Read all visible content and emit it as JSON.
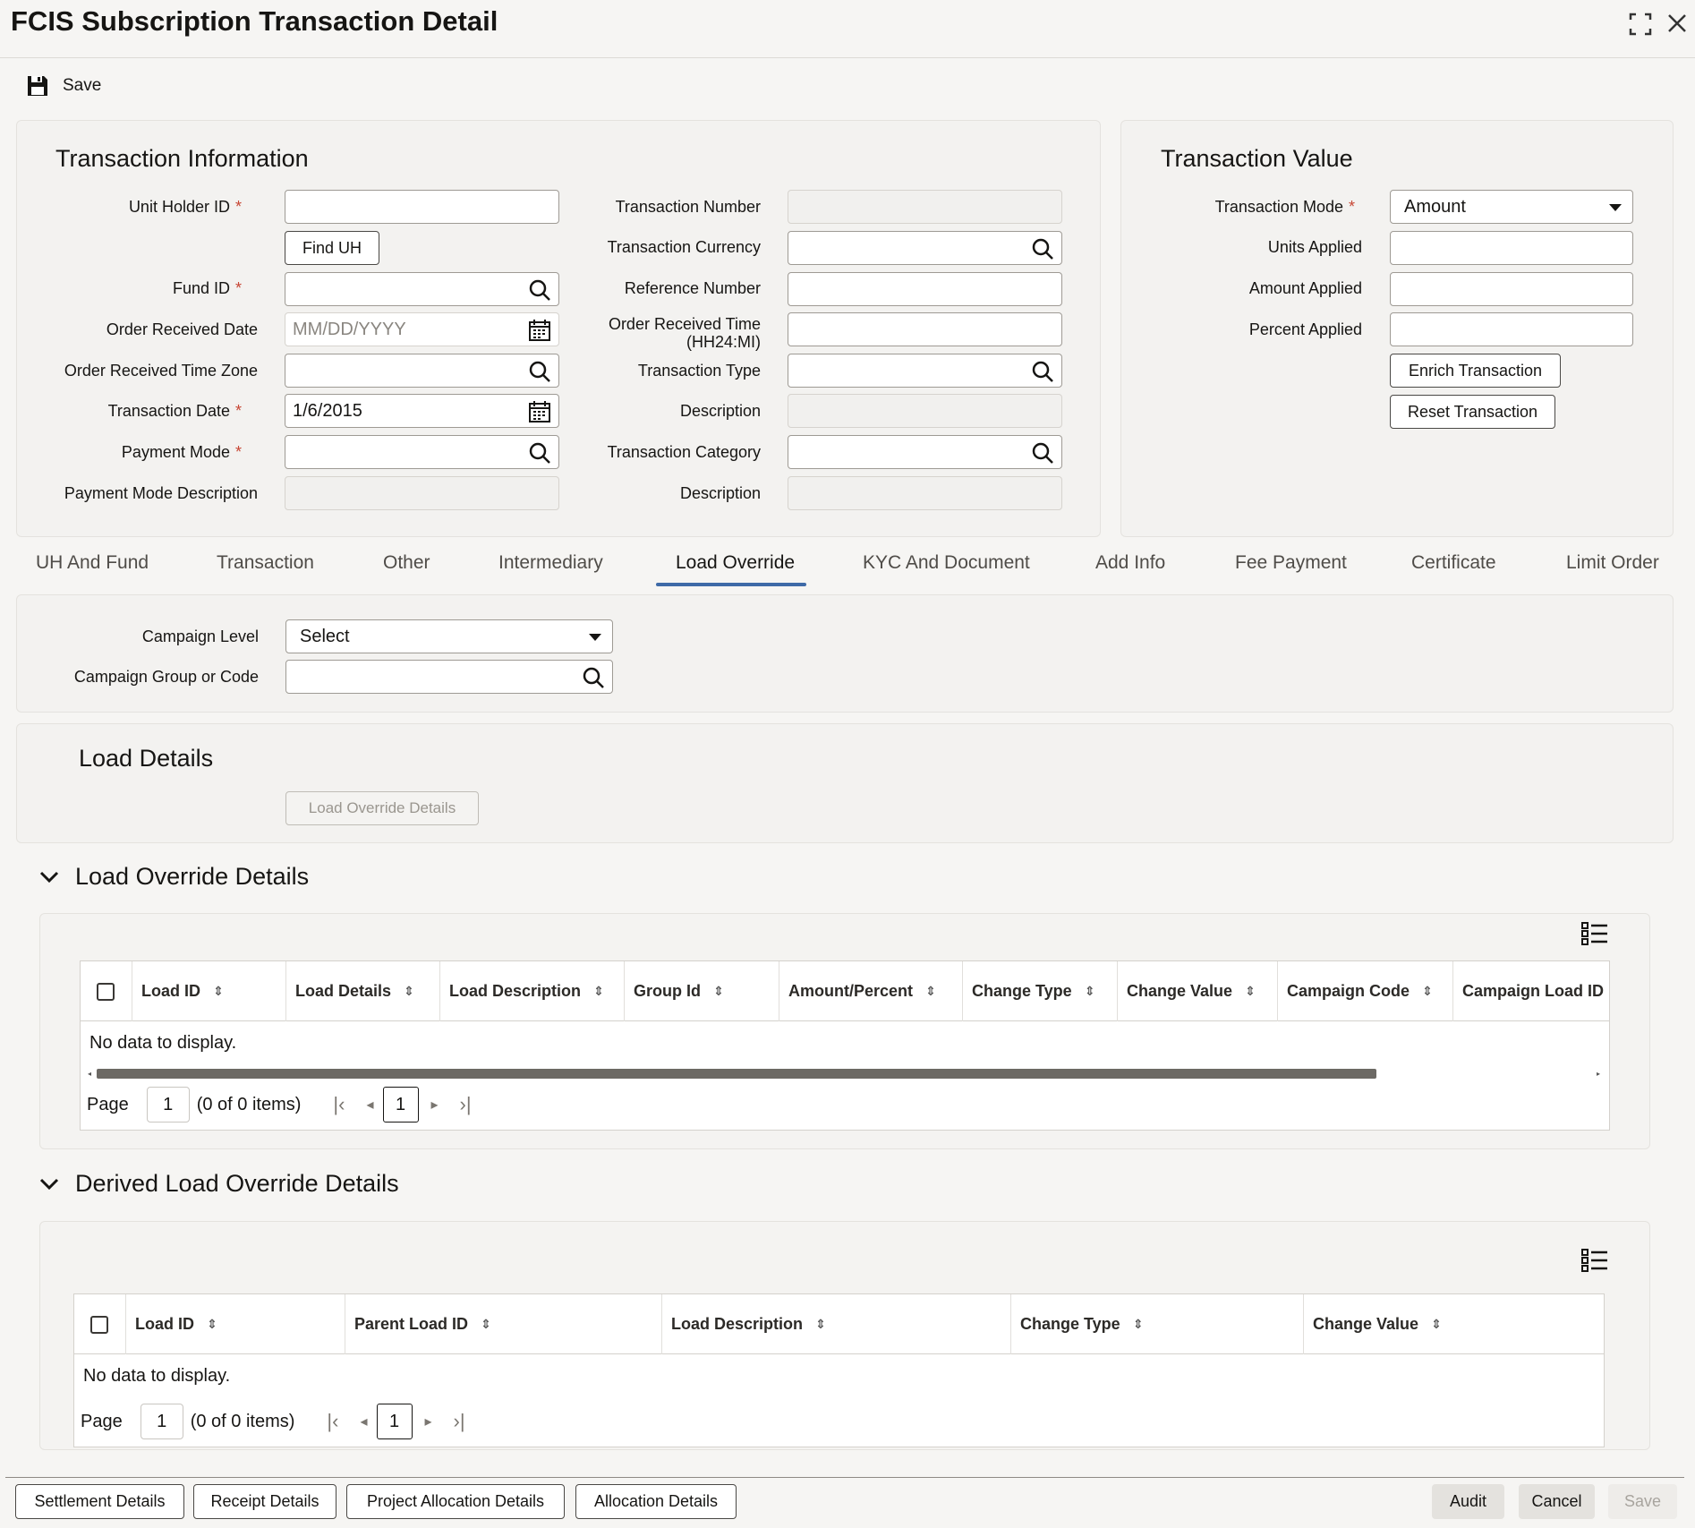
{
  "window": {
    "title": "FCIS Subscription Transaction Detail",
    "maximize_icon": "maximize-icon",
    "close_icon": "close-icon"
  },
  "toolbar": {
    "save_label": "Save"
  },
  "transaction_information": {
    "title": "Transaction Information",
    "unit_holder_id_label": "Unit Holder ID",
    "find_uh_label": "Find UH",
    "fund_id_label": "Fund ID",
    "order_received_date_label": "Order Received Date",
    "order_received_date_placeholder": "MM/DD/YYYY",
    "order_received_time_zone_label": "Order Received Time Zone",
    "transaction_date_label": "Transaction Date",
    "transaction_date_value": "1/6/2015",
    "payment_mode_label": "Payment Mode",
    "payment_mode_description_label": "Payment Mode Description",
    "transaction_number_label": "Transaction Number",
    "transaction_currency_label": "Transaction Currency",
    "reference_number_label": "Reference Number",
    "order_received_time_label_1": "Order Received Time",
    "order_received_time_label_2": "(HH24:MI)",
    "transaction_type_label": "Transaction Type",
    "description_label": "Description",
    "transaction_category_label": "Transaction Category",
    "description2_label": "Description",
    "required_mark": "*"
  },
  "transaction_value": {
    "title": "Transaction Value",
    "transaction_mode_label": "Transaction Mode",
    "transaction_mode_value": "Amount",
    "units_applied_label": "Units Applied",
    "amount_applied_label": "Amount Applied",
    "percent_applied_label": "Percent Applied",
    "enrich_label": "Enrich Transaction",
    "reset_label": "Reset Transaction"
  },
  "tabs": [
    {
      "label": "UH And Fund"
    },
    {
      "label": "Transaction"
    },
    {
      "label": "Other"
    },
    {
      "label": "Intermediary"
    },
    {
      "label": "Load Override"
    },
    {
      "label": "KYC And Document"
    },
    {
      "label": "Add Info"
    },
    {
      "label": "Fee Payment"
    },
    {
      "label": "Certificate"
    },
    {
      "label": "Limit Order"
    }
  ],
  "active_tab": "Load Override",
  "campaign": {
    "level_label": "Campaign Level",
    "level_value": "Select",
    "group_label": "Campaign Group or Code"
  },
  "load_details": {
    "title": "Load Details",
    "button_label": "Load Override Details"
  },
  "load_override_details": {
    "title": "Load Override Details",
    "columns": [
      "Load ID",
      "Load Details",
      "Load Description",
      "Group Id",
      "Amount/Percent",
      "Change Type",
      "Change Value",
      "Campaign Code",
      "Campaign Load ID"
    ],
    "no_data": "No data to display.",
    "page_label": "Page",
    "page_value": "1",
    "items_text": "(0 of 0 items)",
    "current_page": "1"
  },
  "derived_load_override_details": {
    "title": "Derived Load Override Details",
    "columns": [
      "Load ID",
      "Parent Load ID",
      "Load Description",
      "Change Type",
      "Change Value"
    ],
    "no_data": "No data to display.",
    "page_label": "Page",
    "page_value": "1",
    "items_text": "(0 of 0 items)",
    "current_page": "1"
  },
  "footer": {
    "settlement_details": "Settlement Details",
    "receipt_details": "Receipt Details",
    "project_allocation_details": "Project Allocation Details",
    "allocation_details": "Allocation Details",
    "audit": "Audit",
    "cancel": "Cancel",
    "save": "Save"
  },
  "colors": {
    "accent_tab": "#3f6aa7",
    "required": "#c74634",
    "background": "#f6f5f3"
  }
}
